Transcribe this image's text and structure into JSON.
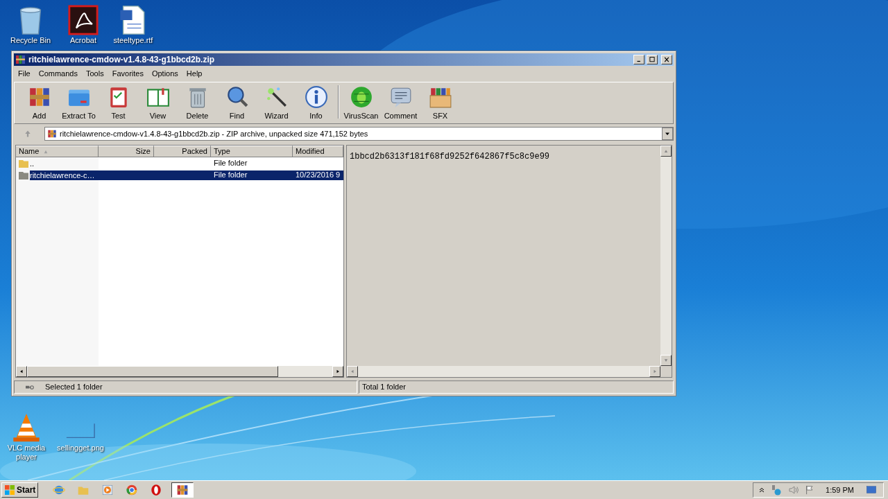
{
  "desktop_icons": [
    {
      "label": "Recycle Bin",
      "kind": "bin"
    },
    {
      "label": "Acrobat",
      "kind": "acrobat"
    },
    {
      "label": "steeltype.rtf",
      "kind": "doc"
    },
    {
      "label": "VLC media player",
      "kind": "vlc"
    },
    {
      "label": "sellingget.png",
      "kind": "blank"
    }
  ],
  "window": {
    "title": "ritchielawrence-cmdow-v1.4.8-43-g1bbcd2b.zip",
    "menu": [
      "File",
      "Commands",
      "Tools",
      "Favorites",
      "Options",
      "Help"
    ],
    "toolbar": [
      {
        "label": "Add",
        "kind": "add"
      },
      {
        "label": "Extract To",
        "kind": "extract"
      },
      {
        "label": "Test",
        "kind": "test"
      },
      {
        "label": "View",
        "kind": "view"
      },
      {
        "label": "Delete",
        "kind": "delete"
      },
      {
        "label": "Find",
        "kind": "find"
      },
      {
        "label": "Wizard",
        "kind": "wizard"
      },
      {
        "label": "Info",
        "kind": "info"
      },
      {
        "label": "VirusScan",
        "kind": "virus"
      },
      {
        "label": "Comment",
        "kind": "comment"
      },
      {
        "label": "SFX",
        "kind": "sfx"
      }
    ],
    "address": "ritchielawrence-cmdow-v1.4.8-43-g1bbcd2b.zip - ZIP archive, unpacked size 471,152 bytes",
    "columns": [
      {
        "label": "Name",
        "sorted": true
      },
      {
        "label": "Size",
        "sorted": false
      },
      {
        "label": "Packed",
        "sorted": false
      },
      {
        "label": "Type",
        "sorted": false
      },
      {
        "label": "Modified",
        "sorted": false
      }
    ],
    "rows": [
      {
        "name": "..",
        "size": "",
        "packed": "",
        "type": "File folder",
        "modified": "",
        "selected": false,
        "kind": "up"
      },
      {
        "name": "ritchielawrence-c…",
        "type": "File folder",
        "modified": "10/23/2016 9",
        "selected": true,
        "kind": "folder"
      }
    ],
    "comment": "1bbcd2b6313f181f68fd9252f642867f5c8c9e99",
    "status_left": "Selected 1 folder",
    "status_right": "Total 1 folder"
  },
  "taskbar": {
    "start": "Start",
    "apps": [
      {
        "kind": "ie",
        "selected": false
      },
      {
        "kind": "explorer",
        "selected": false
      },
      {
        "kind": "media",
        "selected": false
      },
      {
        "kind": "chrome",
        "selected": false
      },
      {
        "kind": "opera",
        "selected": false
      },
      {
        "kind": "winrar",
        "selected": true
      }
    ],
    "clock": "1:59 PM"
  }
}
